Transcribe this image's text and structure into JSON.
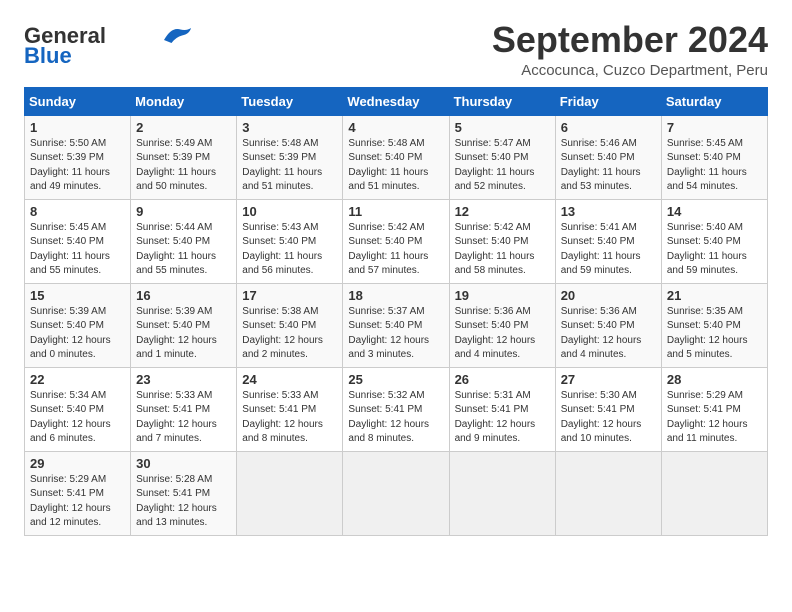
{
  "header": {
    "logo_line1": "General",
    "logo_line2": "Blue",
    "month": "September 2024",
    "location": "Accocunca, Cuzco Department, Peru"
  },
  "weekdays": [
    "Sunday",
    "Monday",
    "Tuesday",
    "Wednesday",
    "Thursday",
    "Friday",
    "Saturday"
  ],
  "weeks": [
    [
      {
        "day": "1",
        "info": "Sunrise: 5:50 AM\nSunset: 5:39 PM\nDaylight: 11 hours\nand 49 minutes."
      },
      {
        "day": "2",
        "info": "Sunrise: 5:49 AM\nSunset: 5:39 PM\nDaylight: 11 hours\nand 50 minutes."
      },
      {
        "day": "3",
        "info": "Sunrise: 5:48 AM\nSunset: 5:39 PM\nDaylight: 11 hours\nand 51 minutes."
      },
      {
        "day": "4",
        "info": "Sunrise: 5:48 AM\nSunset: 5:40 PM\nDaylight: 11 hours\nand 51 minutes."
      },
      {
        "day": "5",
        "info": "Sunrise: 5:47 AM\nSunset: 5:40 PM\nDaylight: 11 hours\nand 52 minutes."
      },
      {
        "day": "6",
        "info": "Sunrise: 5:46 AM\nSunset: 5:40 PM\nDaylight: 11 hours\nand 53 minutes."
      },
      {
        "day": "7",
        "info": "Sunrise: 5:45 AM\nSunset: 5:40 PM\nDaylight: 11 hours\nand 54 minutes."
      }
    ],
    [
      {
        "day": "8",
        "info": "Sunrise: 5:45 AM\nSunset: 5:40 PM\nDaylight: 11 hours\nand 55 minutes."
      },
      {
        "day": "9",
        "info": "Sunrise: 5:44 AM\nSunset: 5:40 PM\nDaylight: 11 hours\nand 55 minutes."
      },
      {
        "day": "10",
        "info": "Sunrise: 5:43 AM\nSunset: 5:40 PM\nDaylight: 11 hours\nand 56 minutes."
      },
      {
        "day": "11",
        "info": "Sunrise: 5:42 AM\nSunset: 5:40 PM\nDaylight: 11 hours\nand 57 minutes."
      },
      {
        "day": "12",
        "info": "Sunrise: 5:42 AM\nSunset: 5:40 PM\nDaylight: 11 hours\nand 58 minutes."
      },
      {
        "day": "13",
        "info": "Sunrise: 5:41 AM\nSunset: 5:40 PM\nDaylight: 11 hours\nand 59 minutes."
      },
      {
        "day": "14",
        "info": "Sunrise: 5:40 AM\nSunset: 5:40 PM\nDaylight: 11 hours\nand 59 minutes."
      }
    ],
    [
      {
        "day": "15",
        "info": "Sunrise: 5:39 AM\nSunset: 5:40 PM\nDaylight: 12 hours\nand 0 minutes."
      },
      {
        "day": "16",
        "info": "Sunrise: 5:39 AM\nSunset: 5:40 PM\nDaylight: 12 hours\nand 1 minute."
      },
      {
        "day": "17",
        "info": "Sunrise: 5:38 AM\nSunset: 5:40 PM\nDaylight: 12 hours\nand 2 minutes."
      },
      {
        "day": "18",
        "info": "Sunrise: 5:37 AM\nSunset: 5:40 PM\nDaylight: 12 hours\nand 3 minutes."
      },
      {
        "day": "19",
        "info": "Sunrise: 5:36 AM\nSunset: 5:40 PM\nDaylight: 12 hours\nand 4 minutes."
      },
      {
        "day": "20",
        "info": "Sunrise: 5:36 AM\nSunset: 5:40 PM\nDaylight: 12 hours\nand 4 minutes."
      },
      {
        "day": "21",
        "info": "Sunrise: 5:35 AM\nSunset: 5:40 PM\nDaylight: 12 hours\nand 5 minutes."
      }
    ],
    [
      {
        "day": "22",
        "info": "Sunrise: 5:34 AM\nSunset: 5:40 PM\nDaylight: 12 hours\nand 6 minutes."
      },
      {
        "day": "23",
        "info": "Sunrise: 5:33 AM\nSunset: 5:41 PM\nDaylight: 12 hours\nand 7 minutes."
      },
      {
        "day": "24",
        "info": "Sunrise: 5:33 AM\nSunset: 5:41 PM\nDaylight: 12 hours\nand 8 minutes."
      },
      {
        "day": "25",
        "info": "Sunrise: 5:32 AM\nSunset: 5:41 PM\nDaylight: 12 hours\nand 8 minutes."
      },
      {
        "day": "26",
        "info": "Sunrise: 5:31 AM\nSunset: 5:41 PM\nDaylight: 12 hours\nand 9 minutes."
      },
      {
        "day": "27",
        "info": "Sunrise: 5:30 AM\nSunset: 5:41 PM\nDaylight: 12 hours\nand 10 minutes."
      },
      {
        "day": "28",
        "info": "Sunrise: 5:29 AM\nSunset: 5:41 PM\nDaylight: 12 hours\nand 11 minutes."
      }
    ],
    [
      {
        "day": "29",
        "info": "Sunrise: 5:29 AM\nSunset: 5:41 PM\nDaylight: 12 hours\nand 12 minutes."
      },
      {
        "day": "30",
        "info": "Sunrise: 5:28 AM\nSunset: 5:41 PM\nDaylight: 12 hours\nand 13 minutes."
      },
      null,
      null,
      null,
      null,
      null
    ]
  ]
}
